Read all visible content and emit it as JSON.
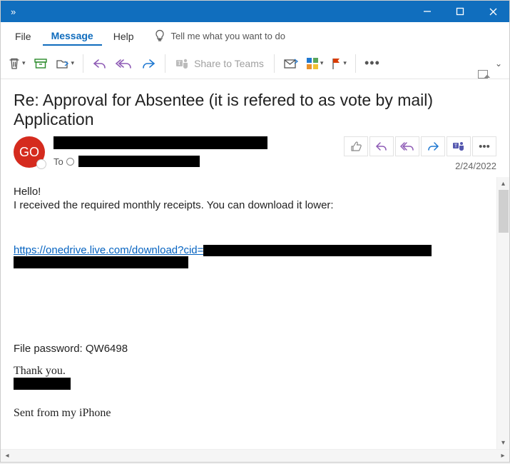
{
  "menu": {
    "file": "File",
    "message": "Message",
    "help": "Help",
    "tellme": "Tell me what you want to do"
  },
  "toolbar": {
    "share_teams": "Share to Teams"
  },
  "email": {
    "subject": "Re: Approval for Absentee (it is refered to as vote by mail) Application",
    "avatar_initials": "GO",
    "to_label": "To",
    "date": "2/24/2022",
    "greeting": "Hello!",
    "intro": "I received the required monthly receipts. You can download it lower:",
    "link_text": "https://onedrive.live.com/download?cid=",
    "password_line": "File password: QW6498",
    "thankyou": "Thank you.",
    "sent_from": "Sent from my iPhone"
  }
}
